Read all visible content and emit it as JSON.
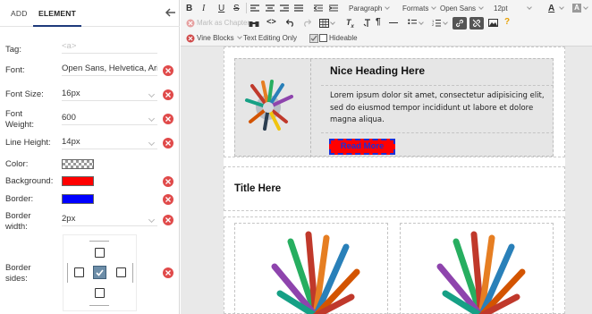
{
  "tabs": [
    {
      "label": "ADD",
      "active": false
    },
    {
      "label": "ELEMENT",
      "active": true
    }
  ],
  "properties": {
    "tag": {
      "label": "Tag:",
      "placeholder": "<a>"
    },
    "font": {
      "label": "Font:",
      "value": "Open Sans, Helvetica, Arial"
    },
    "font_size": {
      "label": "Font Size:",
      "value": "16px"
    },
    "font_weight": {
      "label_line1": "Font",
      "label_line2": "Weight:",
      "value": "600"
    },
    "line_height": {
      "label": "Line Height:",
      "value": "14px"
    },
    "color": {
      "label": "Color:",
      "swatch": "transparent"
    },
    "background": {
      "label": "Background:",
      "swatch": "#ff0000"
    },
    "border": {
      "label": "Border:",
      "swatch": "#0000ff"
    },
    "border_width": {
      "label_line1": "Border",
      "label_line2": "width:",
      "value": "2px"
    },
    "border_sides": {
      "label_line1": "Border",
      "label_line2": "sides:",
      "top": false,
      "left": false,
      "right": false,
      "bottom": false,
      "center": true
    }
  },
  "toolbar": {
    "row1": {
      "bold": "B",
      "italic": "I",
      "underline": "U",
      "strike": "S",
      "paragraph": "Paragraph",
      "formats": "Formats",
      "font_family": "Open Sans",
      "font_size": "12pt",
      "font_color": "A",
      "help": "?"
    },
    "row2": {
      "mark_chapter": "Mark as Chapter",
      "vine_blocks": "Vine Blocks",
      "text_editing_only": "Text Editing Only",
      "hideable": "Hideable"
    }
  },
  "content": {
    "heading": "Nice Heading Here",
    "paragraph": "Lorem ipsum dolor sit amet, consectetur adipisicing elit, sed do eiusmod tempor incididunt ut labore et dolore magna aliqua.",
    "button": "Read More",
    "title": "Title Here"
  },
  "colors": {
    "accent": "#1e3a7b",
    "remove": "#e04a4a",
    "button_bg": "#ff0000",
    "button_border": "#1a2fd8"
  }
}
